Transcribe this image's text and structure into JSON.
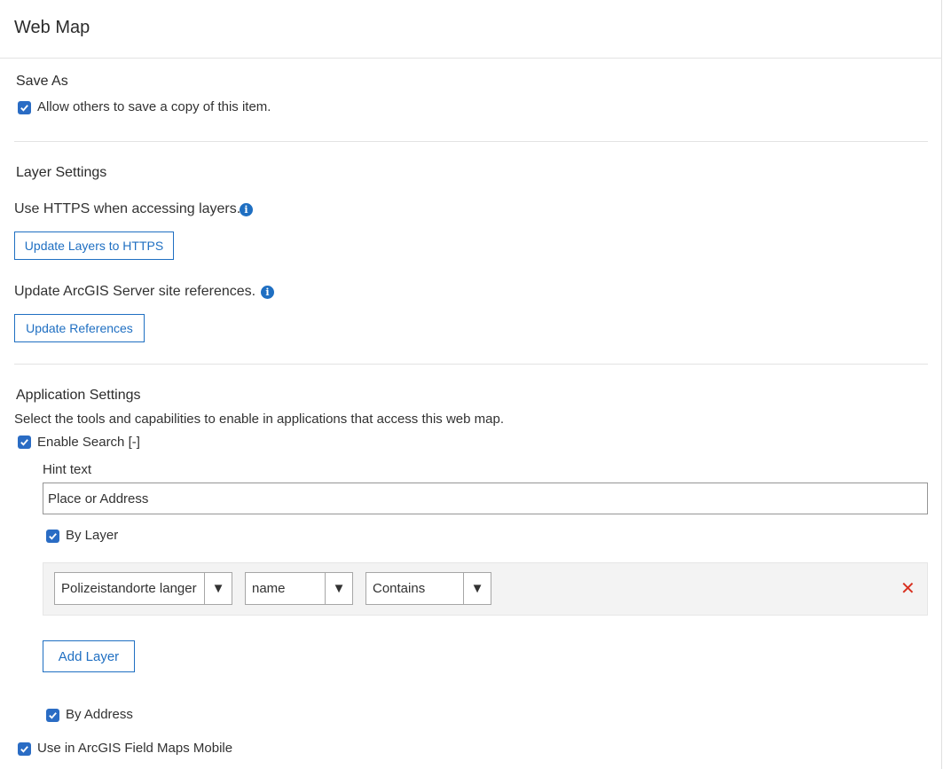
{
  "header": {
    "title": "Web Map"
  },
  "save_as": {
    "title": "Save As",
    "allow_copy_label": "Allow others to save a copy of this item."
  },
  "layer_settings": {
    "title": "Layer Settings",
    "https_text": "Use HTTPS when accessing layers.",
    "https_button": "Update Layers to HTTPS",
    "references_text": "Update ArcGIS Server site references.",
    "references_button": "Update References"
  },
  "app_settings": {
    "title": "Application Settings",
    "description": "Select the tools and capabilities to enable in applications that access this web map.",
    "enable_search_label": "Enable Search [-]",
    "hint_text_label": "Hint text",
    "hint_text_value": "Place or Address",
    "by_layer_label": "By Layer",
    "layer_row": {
      "layer_select": "Polizeistandorte langer",
      "field_select": "name",
      "operator_select": "Contains",
      "arrow": "▼",
      "remove": "✕"
    },
    "add_layer_button": "Add Layer",
    "by_address_label": "By Address",
    "field_maps_label": "Use in ArcGIS Field Maps Mobile"
  },
  "icons": {
    "info": "i"
  },
  "colors": {
    "accent": "#1f6fc2",
    "checkbox": "#2a6cc4",
    "remove": "#d83020"
  }
}
